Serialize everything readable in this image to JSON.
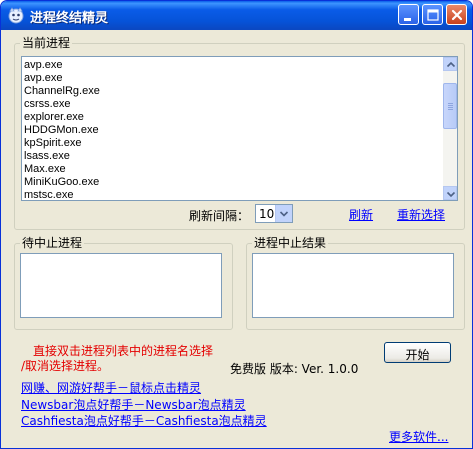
{
  "window": {
    "title": "进程终结精灵"
  },
  "current_processes": {
    "label": "当前进程",
    "items": [
      "avp.exe",
      "avp.exe",
      "ChannelRg.exe",
      "csrss.exe",
      "explorer.exe",
      "HDDGMon.exe",
      "kpSpirit.exe",
      "lsass.exe",
      "Max.exe",
      "MiniKuGoo.exe",
      "mstsc.exe"
    ],
    "scroll_position": 0.18
  },
  "refresh": {
    "interval_label": "刷新间隔：",
    "interval_value": "10",
    "refresh_link": "刷新",
    "reselect_link": "重新选择"
  },
  "pending_group": {
    "label": "待中止进程"
  },
  "result_group": {
    "label": "进程中止结果"
  },
  "hint": {
    "line1": "直接双击进程列表中的进程名选择",
    "line2": "/取消选择进程。"
  },
  "version_text": "免费版 版本: Ver. 1.0.0",
  "start_button_label": "开始",
  "links": [
    "网赚、网游好帮手－鼠标点击精灵",
    "Newsbar泡点好帮手－Newsbar泡点精灵",
    "Cashfiesta泡点好帮手－Cashfiesta泡点精灵"
  ],
  "more_link": "更多软件...",
  "icons": {
    "app": "app-icon",
    "minimize": "minimize-icon",
    "maximize": "maximize-icon",
    "close": "close-icon"
  }
}
